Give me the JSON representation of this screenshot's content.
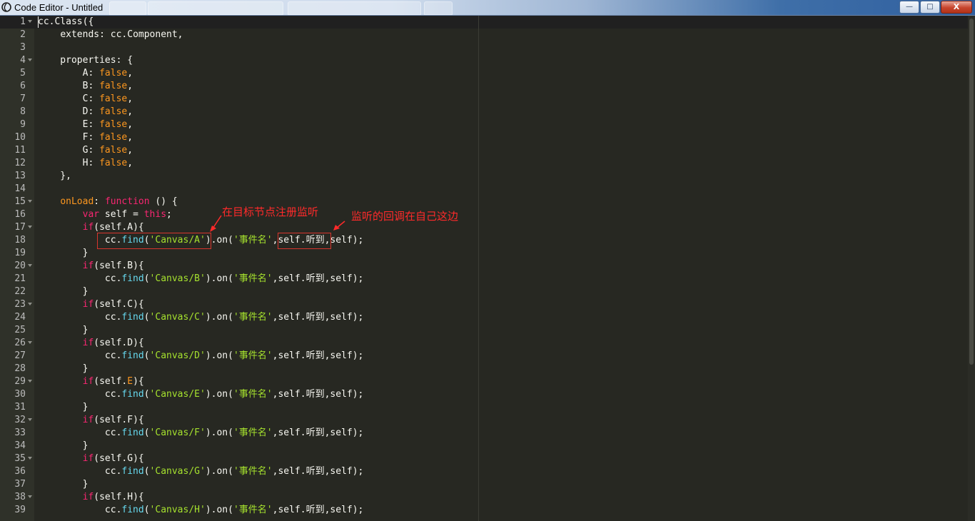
{
  "window": {
    "title": "Code Editor - Untitled",
    "buttons": {
      "minimize": "—",
      "maximize": "□",
      "close": "X"
    }
  },
  "editor": {
    "lines": [
      {
        "n": "1",
        "fold": true,
        "html": "cc.Class({"
      },
      {
        "n": "2",
        "fold": false,
        "html": "    <span class=\"prop\">extends</span>: cc.Component,"
      },
      {
        "n": "3",
        "fold": false,
        "html": ""
      },
      {
        "n": "4",
        "fold": true,
        "html": "    properties: {"
      },
      {
        "n": "5",
        "fold": false,
        "html": "        A: <span class=\"bool\">false</span>,"
      },
      {
        "n": "6",
        "fold": false,
        "html": "        B: <span class=\"bool\">false</span>,"
      },
      {
        "n": "7",
        "fold": false,
        "html": "        C: <span class=\"bool\">false</span>,"
      },
      {
        "n": "8",
        "fold": false,
        "html": "        D: <span class=\"bool\">false</span>,"
      },
      {
        "n": "9",
        "fold": false,
        "html": "        E: <span class=\"bool\">false</span>,"
      },
      {
        "n": "10",
        "fold": false,
        "html": "        F: <span class=\"bool\">false</span>,"
      },
      {
        "n": "11",
        "fold": false,
        "html": "        G: <span class=\"bool\">false</span>,"
      },
      {
        "n": "12",
        "fold": false,
        "html": "        H: <span class=\"bool\">false</span>,"
      },
      {
        "n": "13",
        "fold": false,
        "html": "    },"
      },
      {
        "n": "14",
        "fold": false,
        "html": ""
      },
      {
        "n": "15",
        "fold": true,
        "html": "    <span class=\"key\">onLoad</span>: <span class=\"kw\">function</span> () {"
      },
      {
        "n": "16",
        "fold": false,
        "html": "        <span class=\"kw\">var</span> self = <span class=\"kw\">this</span>;"
      },
      {
        "n": "17",
        "fold": true,
        "html": "        <span class=\"kw\">if</span>(self.A){"
      },
      {
        "n": "18",
        "fold": false,
        "html": "            cc.<span class=\"fn\">find</span>(<span class=\"str\">'Canvas/A'</span>).on(<span class=\"str\">'事件名'</span>,self.听到,self);"
      },
      {
        "n": "19",
        "fold": false,
        "html": "        }"
      },
      {
        "n": "20",
        "fold": true,
        "html": "        <span class=\"kw\">if</span>(self.B){"
      },
      {
        "n": "21",
        "fold": false,
        "html": "            cc.<span class=\"fn\">find</span>(<span class=\"str\">'Canvas/B'</span>).on(<span class=\"str\">'事件名'</span>,self.听到,self);"
      },
      {
        "n": "22",
        "fold": false,
        "html": "        }"
      },
      {
        "n": "23",
        "fold": true,
        "html": "        <span class=\"kw\">if</span>(self.C){"
      },
      {
        "n": "24",
        "fold": false,
        "html": "            cc.<span class=\"fn\">find</span>(<span class=\"str\">'Canvas/C'</span>).on(<span class=\"str\">'事件名'</span>,self.听到,self);"
      },
      {
        "n": "25",
        "fold": false,
        "html": "        }"
      },
      {
        "n": "26",
        "fold": true,
        "html": "        <span class=\"kw\">if</span>(self.D){"
      },
      {
        "n": "27",
        "fold": false,
        "html": "            cc.<span class=\"fn\">find</span>(<span class=\"str\">'Canvas/D'</span>).on(<span class=\"str\">'事件名'</span>,self.听到,self);"
      },
      {
        "n": "28",
        "fold": false,
        "html": "        }"
      },
      {
        "n": "29",
        "fold": true,
        "html": "        <span class=\"kw\">if</span>(self.<span class=\"bool\">E</span>){"
      },
      {
        "n": "30",
        "fold": false,
        "html": "            cc.<span class=\"fn\">find</span>(<span class=\"str\">'Canvas/E'</span>).on(<span class=\"str\">'事件名'</span>,self.听到,self);"
      },
      {
        "n": "31",
        "fold": false,
        "html": "        }"
      },
      {
        "n": "32",
        "fold": true,
        "html": "        <span class=\"kw\">if</span>(self.F){"
      },
      {
        "n": "33",
        "fold": false,
        "html": "            cc.<span class=\"fn\">find</span>(<span class=\"str\">'Canvas/F'</span>).on(<span class=\"str\">'事件名'</span>,self.听到,self);"
      },
      {
        "n": "34",
        "fold": false,
        "html": "        }"
      },
      {
        "n": "35",
        "fold": true,
        "html": "        <span class=\"kw\">if</span>(self.G){"
      },
      {
        "n": "36",
        "fold": false,
        "html": "            cc.<span class=\"fn\">find</span>(<span class=\"str\">'Canvas/G'</span>).on(<span class=\"str\">'事件名'</span>,self.听到,self);"
      },
      {
        "n": "37",
        "fold": false,
        "html": "        }"
      },
      {
        "n": "38",
        "fold": true,
        "html": "        <span class=\"kw\">if</span>(self.H){"
      },
      {
        "n": "39",
        "fold": false,
        "html": "            cc.<span class=\"fn\">find</span>(<span class=\"str\">'Canvas/H'</span>).on(<span class=\"str\">'事件名'</span>,self.听到,self);"
      }
    ]
  },
  "annotations": {
    "note_register": "在目标节点注册监听",
    "note_callback": "监听的回调在自己这边"
  },
  "colors": {
    "annotation": "#ff2a2a",
    "background": "#272822"
  }
}
